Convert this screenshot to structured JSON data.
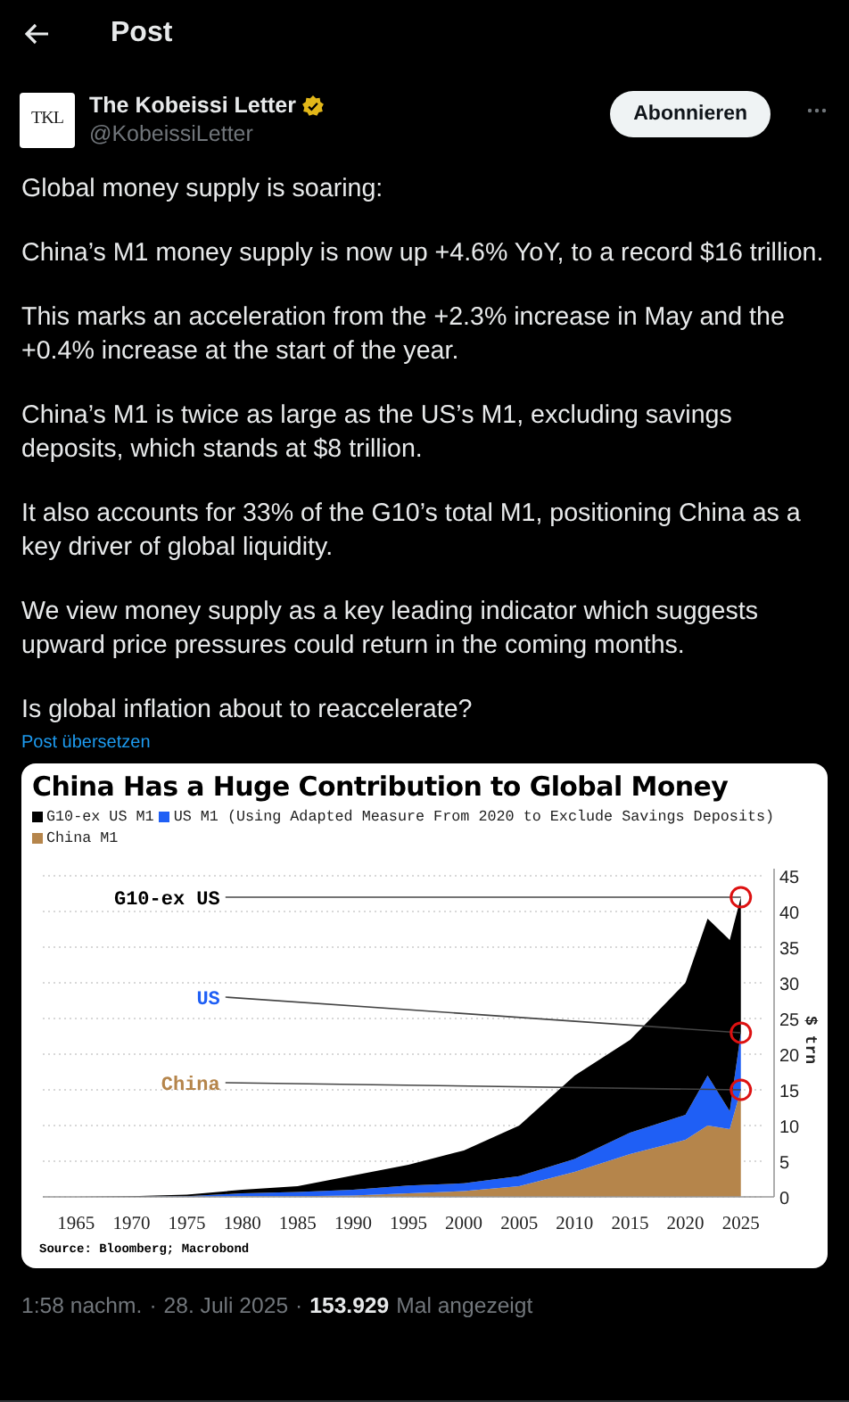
{
  "header": {
    "title": "Post"
  },
  "author": {
    "avatar_text": "TKL",
    "name": "The Kobeissi Letter",
    "verified": true,
    "handle": "@KobeissiLetter",
    "follow_label": "Abonnieren"
  },
  "paragraphs": [
    "Global money supply is soaring:",
    "China’s M1 money supply is now up +4.6% YoY, to a record $16 trillion.",
    "This marks an acceleration from the +2.3% increase in May and the +0.4% increase at the start of the year.",
    "China’s M1 is twice as large as the US’s M1, excluding savings deposits, which stands at $8 trillion.",
    "It also accounts for 33% of the G10’s total M1, positioning China as a key driver of global liquidity.",
    "We view money supply as a key leading indicator which suggests upward price pressures could return in the coming months.",
    "Is global inflation about to reaccelerate?"
  ],
  "translate_link": "Post übersetzen",
  "chart": {
    "source": "Source: Bloomberg; Macrobond",
    "chart_data": {
      "type": "area",
      "title": "China Has a Huge Contribution to Global Money",
      "ylabel": "$ trn",
      "stacked": true,
      "x": [
        1965,
        1970,
        1975,
        1980,
        1985,
        1990,
        1995,
        2000,
        2005,
        2010,
        2015,
        2020,
        2022,
        2024,
        2025
      ],
      "series": [
        {
          "name": "China M1",
          "color": "#b5854b",
          "values": [
            0,
            0,
            0,
            0.1,
            0.1,
            0.2,
            0.5,
            0.8,
            1.5,
            3.5,
            6,
            8,
            10,
            9.5,
            15
          ]
        },
        {
          "name": "US M1 (Using Adapted Measure From 2020 to Exclude Savings Deposits)",
          "color": "#1f5ff5",
          "values": [
            0,
            0,
            0.1,
            0.4,
            0.6,
            0.8,
            1.1,
            1.1,
            1.4,
            1.8,
            3,
            3.5,
            7,
            2.5,
            8
          ]
        },
        {
          "name": "G10-ex US M1",
          "color": "#000000",
          "values": [
            0,
            0.1,
            0.2,
            0.5,
            0.8,
            2,
            2.9,
            4.6,
            7.1,
            11.7,
            13,
            18.5,
            22,
            24,
            19
          ]
        }
      ],
      "grid": true,
      "xlim": [
        1962,
        2028
      ],
      "ylim": [
        0,
        45
      ],
      "xticks": [
        1965,
        1970,
        1975,
        1980,
        1985,
        1990,
        1995,
        2000,
        2005,
        2010,
        2015,
        2020,
        2025
      ],
      "yticks": [
        0,
        5,
        10,
        15,
        20,
        25,
        30,
        35,
        40,
        45
      ],
      "annotations": [
        "G10-ex US",
        "US",
        "China"
      ]
    }
  },
  "meta": {
    "time": "1:58 nachm.",
    "date": "28. Juli 2025",
    "views_count": "153.929",
    "views_label": "Mal angezeigt",
    "separator": "·"
  }
}
